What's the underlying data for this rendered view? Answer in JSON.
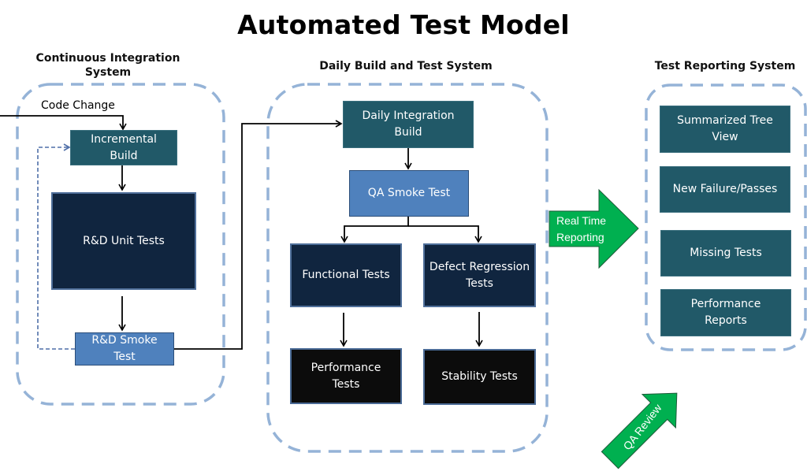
{
  "title": "Automated Test Model",
  "sections": {
    "ci": {
      "label": "Continuous Integration\nSystem"
    },
    "daily": {
      "label": "Daily Build and Test System"
    },
    "reporting": {
      "label": "Test Reporting System"
    }
  },
  "edges": {
    "code_change": "Code Change"
  },
  "nodes": {
    "incremental_build": "Incremental\nBuild",
    "rd_unit_tests": "R&D Unit Tests",
    "rd_smoke_test": "R&D Smoke\nTest",
    "daily_integration_build": "Daily Integration\nBuild",
    "qa_smoke_test": "QA Smoke Test",
    "functional_tests": "Functional Tests",
    "defect_regression_tests": "Defect Regression\nTests",
    "performance_tests": "Performance\nTests",
    "stability_tests": "Stability Tests",
    "summarized_tree_view": "Summarized Tree\nView",
    "new_failure_passes": "New Failure/Passes",
    "missing_tests": "Missing Tests",
    "performance_reports": "Performance\nReports"
  },
  "callouts": {
    "real_time_reporting": "Real Time\nReporting",
    "qa_review": "QA Review"
  },
  "colors": {
    "teal_box": "#215968",
    "navy_box": "#10253f",
    "blue_box": "#4f81bd",
    "black_box": "#0c0c0c",
    "container_dash": "#95b3d7",
    "green_arrow": "#00b050"
  }
}
